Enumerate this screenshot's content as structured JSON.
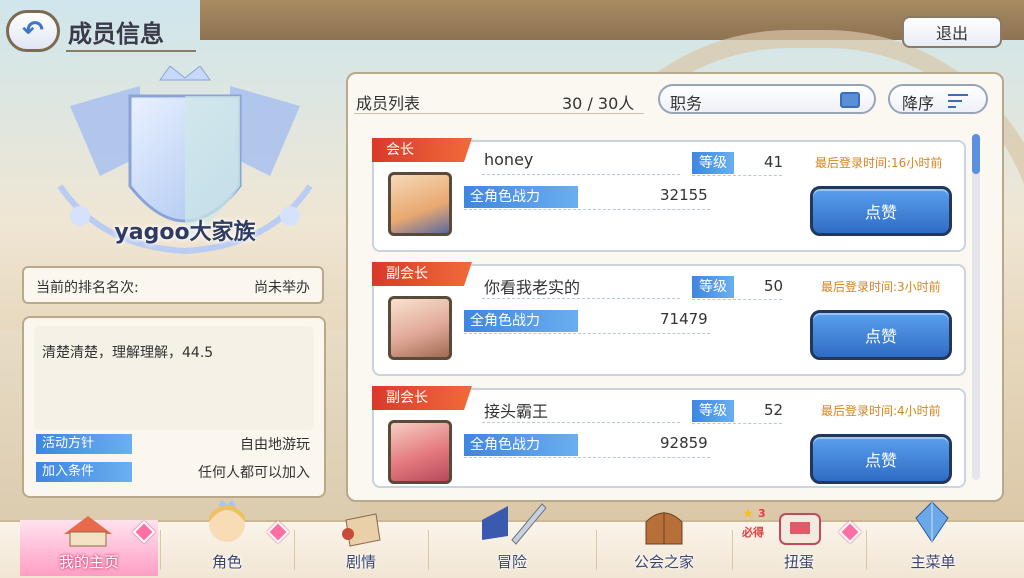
{
  "header": {
    "title": "成员信息",
    "exit_label": "退出"
  },
  "clan": {
    "name": "yagoo大家族",
    "rank_label": "当前的排名名次:",
    "rank_value": "尚未举办",
    "description": "清楚清楚，理解理解，44.5",
    "policy_label": "活动方针",
    "policy_value": "自由地游玩",
    "join_label": "加入条件",
    "join_value": "任何人都可以加入"
  },
  "member_list": {
    "label": "成员列表",
    "count": "30 / 30人",
    "filter_label": "职务",
    "sort_label": "降序"
  },
  "members": [
    {
      "role": "会长",
      "name": "honey",
      "level_label": "等级",
      "level": "41",
      "last_login": "最后登录时间:16小时前",
      "power_label": "全角色战力",
      "power": "32155",
      "like_label": "点赞"
    },
    {
      "role": "副会长",
      "name": "你看我老实的",
      "level_label": "等级",
      "level": "50",
      "last_login": "最后登录时间:3小时前",
      "power_label": "全角色战力",
      "power": "71479",
      "like_label": "点赞"
    },
    {
      "role": "副会长",
      "name": "接头霸王",
      "level_label": "等级",
      "level": "52",
      "last_login": "最后登录时间:4小时前",
      "power_label": "全角色战力",
      "power": "92859",
      "like_label": "点赞"
    }
  ],
  "nav": {
    "items": [
      {
        "label": "我的主页"
      },
      {
        "label": "角色"
      },
      {
        "label": "剧情"
      },
      {
        "label": "冒险"
      },
      {
        "label": "公会之家"
      },
      {
        "label": "扭蛋"
      },
      {
        "label": "主菜单"
      }
    ],
    "gacha_badge_count": "3",
    "gacha_badge_text": "必得"
  },
  "colors": {
    "accent_blue": "#3f86df",
    "role_red": "#d83a2a",
    "login_orange": "#d68420",
    "nav_active_pink": "#ff9ec4"
  }
}
